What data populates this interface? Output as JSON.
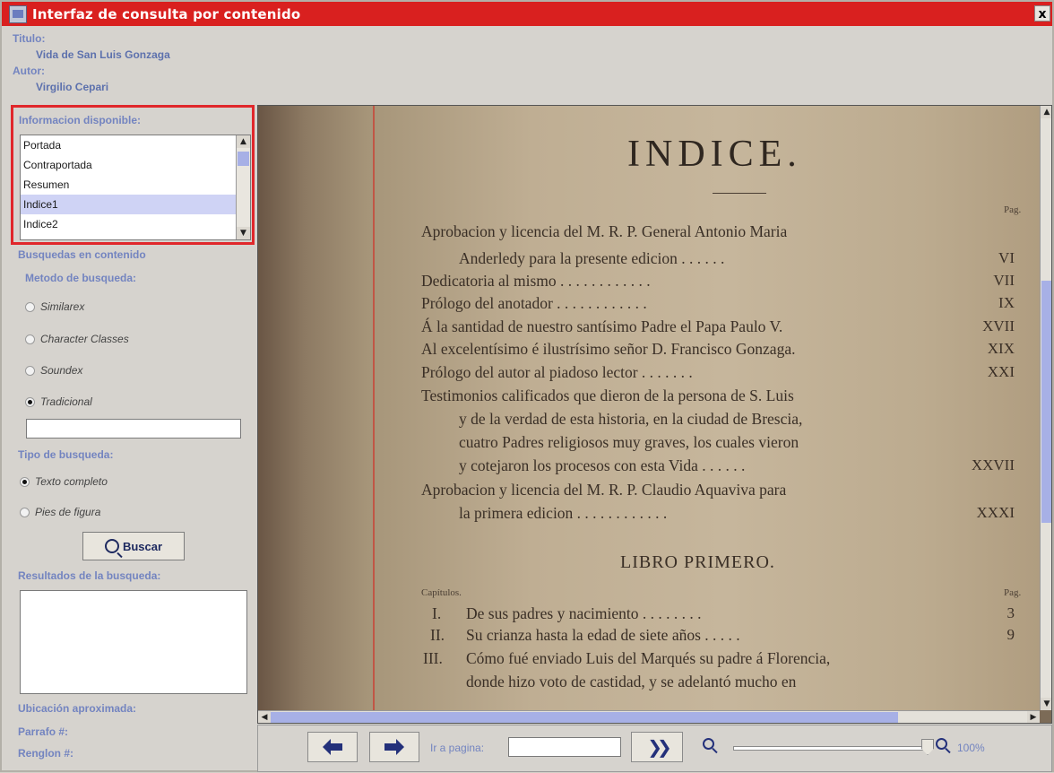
{
  "window": {
    "title": "Interfaz de consulta por contenido",
    "close_label": "x"
  },
  "meta": {
    "title_label": "Titulo:",
    "title_value": "Vida de San Luis Gonzaga",
    "author_label": "Autor:",
    "author_value": "Virgilio Cepari"
  },
  "info": {
    "label": "Informacion disponible:",
    "items": [
      "Portada",
      "Contraportada",
      "Resumen",
      "Indice1",
      "Indice2"
    ],
    "selected": "Indice1"
  },
  "search": {
    "section_label": "Busquedas en contenido",
    "method_label": "Metodo de busqueda:",
    "methods": [
      {
        "label": "Similarex",
        "checked": false
      },
      {
        "label": "Character Classes",
        "checked": false
      },
      {
        "label": "Soundex",
        "checked": false
      },
      {
        "label": "Tradicional",
        "checked": true
      }
    ],
    "query_value": "",
    "type_label": "Tipo de busqueda:",
    "types": [
      {
        "label": "Texto completo",
        "checked": true
      },
      {
        "label": "Pies de figura",
        "checked": false
      }
    ],
    "search_button": "Buscar",
    "results_label": "Resultados de la busqueda:",
    "location_label": "Ubicación aproximada:",
    "paragraph_label": "Parrafo #:",
    "line_label": "Renglon #:"
  },
  "document": {
    "heading": "INDICE.",
    "pag_label": "Pag.",
    "entries": [
      {
        "text": "Aprobacion y licencia del M. R. P. General Antonio Maria",
        "page": ""
      },
      {
        "text": "Anderledy para la presente edicion . . . . . .",
        "page": "VI",
        "indent": true
      },
      {
        "text": "Dedicatoria al mismo . . . . . . . . . . . .",
        "page": "VII"
      },
      {
        "text": "Prólogo del anotador . . . . . . . . . . . .",
        "page": "IX"
      },
      {
        "text": "Á la santidad de nuestro santísimo Padre el Papa Paulo V.",
        "page": "XVII"
      },
      {
        "text": "Al excelentísimo é ilustrísimo señor D. Francisco Gonzaga.",
        "page": "XIX"
      },
      {
        "text": "Prólogo del autor al piadoso lector . . . . . . .",
        "page": "XXI"
      },
      {
        "text": "Testimonios calificados que dieron de la persona de S. Luis",
        "page": ""
      },
      {
        "text": "y de la verdad de esta historia, en la ciudad de Brescia,",
        "page": "",
        "indent": true
      },
      {
        "text": "cuatro Padres religiosos muy graves, los cuales vieron",
        "page": "",
        "indent": true
      },
      {
        "text": "y cotejaron los procesos con esta Vida . . . . . .",
        "page": "XXVII",
        "indent": true
      },
      {
        "text": "Aprobacion y licencia del M. R. P. Claudio Aquaviva para",
        "page": ""
      },
      {
        "text": "la primera edicion . . . . . . . . . . . .",
        "page": "XXXI",
        "indent": true
      }
    ],
    "book_heading": "LIBRO PRIMERO.",
    "chapters_label": "Capítulos.",
    "chapters": [
      {
        "num": "I.",
        "text": "De sus padres y nacimiento . . . . . . . .",
        "page": "3"
      },
      {
        "num": "II.",
        "text": "Su crianza hasta la edad de siete años . . . . .",
        "page": "9"
      },
      {
        "num": "III.",
        "text": "Cómo fué enviado Luis del Marqués su padre á Florencia,",
        "page": ""
      },
      {
        "num": "",
        "text": "donde hizo voto de castidad, y se adelantó mucho en",
        "page": ""
      }
    ]
  },
  "toolbar": {
    "goto_label": "Ir a pagina:",
    "goto_value": "",
    "zoom_value": "100%",
    "zoom_level": 1.0
  },
  "colors": {
    "title_bar": "#d9201f",
    "highlight_border": "#e0272b",
    "label": "#7384c0",
    "selection": "#cfd3f5",
    "scroll_thumb": "#a7b0e6"
  }
}
